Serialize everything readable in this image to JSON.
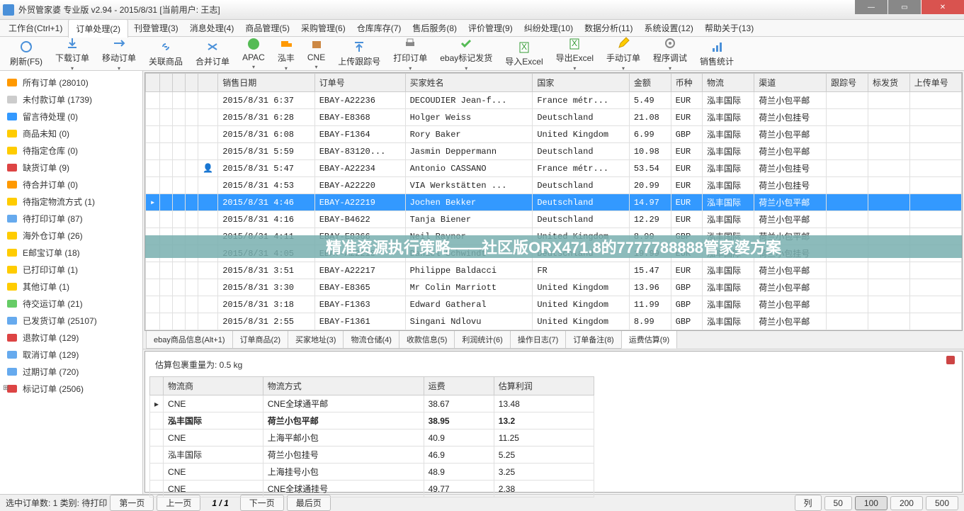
{
  "window": {
    "title": "外贸管家婆 专业版 v2.94 - 2015/8/31 [当前用户: 王志]"
  },
  "menu": {
    "workbench": "工作台(Ctrl+1)",
    "order_proc": "订单处理(2)",
    "listing": "刊登管理(3)",
    "msg": "消息处理(4)",
    "goods": "商品管理(5)",
    "purchase": "采购管理(6)",
    "warehouse": "仓库库存(7)",
    "aftersale": "售后服务(8)",
    "evaluate": "评价管理(9)",
    "dispute": "纠纷处理(10)",
    "analytics": "数据分析(11)",
    "settings": "系统设置(12)",
    "help": "帮助关于(13)"
  },
  "toolbar": {
    "refresh": "刷新(F5)",
    "download": "下载订单",
    "move": "移动订单",
    "relate": "关联商品",
    "merge": "合并订单",
    "apac": "APAC",
    "hongfeng": "泓丰",
    "cne": "CNE",
    "upload_track": "上传跟踪号",
    "print": "打印订单",
    "ship_mark": "ebay标记发货",
    "import": "导入Excel",
    "export": "导出Excel",
    "manual": "手动订单",
    "debug": "程序调试",
    "stats": "销售统计"
  },
  "sidebar": {
    "items": [
      {
        "label": "所有订单 (28010)",
        "color": "#ff9900"
      },
      {
        "label": "未付款订单 (1739)",
        "color": "#cccccc"
      },
      {
        "label": "留言待处理 (0)",
        "color": "#3399ff"
      },
      {
        "label": "商品未知 (0)",
        "color": "#ffcc00"
      },
      {
        "label": "待指定仓库 (0)",
        "color": "#ffcc00"
      },
      {
        "label": "缺货订单 (9)",
        "color": "#dd4444"
      },
      {
        "label": "待合并订单 (0)",
        "color": "#ff9900"
      },
      {
        "label": "待指定物流方式 (1)",
        "color": "#ffcc00"
      },
      {
        "label": "待打印订单 (87)",
        "color": "#66aaee"
      },
      {
        "label": "海外仓订单 (26)",
        "color": "#ffcc00"
      },
      {
        "label": "E邮宝订单 (18)",
        "color": "#ffcc00"
      },
      {
        "label": "已打印订单 (1)",
        "color": "#ffcc00"
      },
      {
        "label": "其他订单 (1)",
        "color": "#ffcc00"
      },
      {
        "label": "待交运订单 (21)",
        "color": "#66cc66"
      },
      {
        "label": "已发货订单 (25107)",
        "color": "#66aaee"
      },
      {
        "label": "退款订单 (129)",
        "color": "#dd4444"
      },
      {
        "label": "取消订单 (129)",
        "color": "#66aaee"
      },
      {
        "label": "过期订单 (720)",
        "color": "#66aaee"
      },
      {
        "label": "标记订单 (2506)",
        "color": "#dd4444"
      }
    ]
  },
  "grid": {
    "headers": {
      "sale_date": "销售日期",
      "order_no": "订单号",
      "buyer": "买家姓名",
      "country": "国家",
      "amount": "金额",
      "currency": "币种",
      "logistics": "物流",
      "channel": "渠道",
      "track": "跟踪号",
      "shipped": "标发货",
      "upload": "上传单号"
    },
    "rows": [
      {
        "date": "2015/8/31 6:37",
        "no": "EBAY-A22236",
        "buyer": "DECOUDIER Jean-f...",
        "country": "France métr...",
        "amt": "5.49",
        "cur": "EUR",
        "log": "泓丰国际",
        "ch": "荷兰小包平邮"
      },
      {
        "date": "2015/8/31 6:28",
        "no": "EBAY-E8368",
        "buyer": "Holger Weiss",
        "country": "Deutschland",
        "amt": "21.08",
        "cur": "EUR",
        "log": "泓丰国际",
        "ch": "荷兰小包挂号"
      },
      {
        "date": "2015/8/31 6:08",
        "no": "EBAY-F1364",
        "buyer": "Rory Baker",
        "country": "United Kingdom",
        "amt": "6.99",
        "cur": "GBP",
        "log": "泓丰国际",
        "ch": "荷兰小包平邮"
      },
      {
        "date": "2015/8/31 5:59",
        "no": "EBAY-83120...",
        "buyer": "Jasmin Deppermann",
        "country": "Deutschland",
        "amt": "10.98",
        "cur": "EUR",
        "log": "泓丰国际",
        "ch": "荷兰小包平邮"
      },
      {
        "date": "2015/8/31 5:47",
        "no": "EBAY-A22234",
        "buyer": "Antonio CASSANO",
        "country": "France métr...",
        "amt": "53.54",
        "cur": "EUR",
        "log": "泓丰国际",
        "ch": "荷兰小包挂号",
        "icon": true
      },
      {
        "date": "2015/8/31 4:53",
        "no": "EBAY-A22220",
        "buyer": "VIA Werkstätten ...",
        "country": "Deutschland",
        "amt": "20.99",
        "cur": "EUR",
        "log": "泓丰国际",
        "ch": "荷兰小包挂号"
      },
      {
        "date": "2015/8/31 4:46",
        "no": "EBAY-A22219",
        "buyer": "Jochen Bekker",
        "country": "Deutschland",
        "amt": "14.97",
        "cur": "EUR",
        "log": "泓丰国际",
        "ch": "荷兰小包平邮",
        "sel": true
      },
      {
        "date": "2015/8/31 4:16",
        "no": "EBAY-B4622",
        "buyer": "Tanja Biener",
        "country": "Deutschland",
        "amt": "12.29",
        "cur": "EUR",
        "log": "泓丰国际",
        "ch": "荷兰小包平邮"
      },
      {
        "date": "2015/8/31 4:11",
        "no": "EBAY-E8366",
        "buyer": "Neil Raynor",
        "country": "United Kingdom",
        "amt": "8.99",
        "cur": "GBP",
        "log": "泓丰国际",
        "ch": "荷兰小包平邮"
      },
      {
        "date": "2015/8/31 4:05",
        "no": "EBAY-A22218",
        "buyer": "Daniel Schwindt",
        "country": "Deutschland",
        "amt": "19.99",
        "cur": "EUR",
        "log": "泓丰国际",
        "ch": "荷兰小包挂号",
        "ov": true
      },
      {
        "date": "2015/8/31 3:51",
        "no": "EBAY-A22217",
        "buyer": "Philippe Baldacci",
        "country": "FR",
        "amt": "15.47",
        "cur": "EUR",
        "log": "泓丰国际",
        "ch": "荷兰小包平邮",
        "ov": true
      },
      {
        "date": "2015/8/31 3:30",
        "no": "EBAY-E8365",
        "buyer": "Mr Colin Marriott",
        "country": "United Kingdom",
        "amt": "13.96",
        "cur": "GBP",
        "log": "泓丰国际",
        "ch": "荷兰小包平邮"
      },
      {
        "date": "2015/8/31 3:18",
        "no": "EBAY-F1363",
        "buyer": "Edward Gatheral",
        "country": "United Kingdom",
        "amt": "11.99",
        "cur": "GBP",
        "log": "泓丰国际",
        "ch": "荷兰小包平邮"
      },
      {
        "date": "2015/8/31 2:55",
        "no": "EBAY-F1361",
        "buyer": "Singani Ndlovu",
        "country": "United Kingdom",
        "amt": "8.99",
        "cur": "GBP",
        "log": "泓丰国际",
        "ch": "荷兰小包平邮"
      }
    ]
  },
  "overlay": {
    "text": "精准资源执行策略——社区版ORX471.8的7777788888管家婆方案"
  },
  "subtabs": {
    "ebay_info": "ebay商品信息(Alt+1)",
    "order_goods": "订单商品(2)",
    "buyer_addr": "买家地址(3)",
    "wh_ship": "物流仓储(4)",
    "payment": "收款信息(5)",
    "profit": "利润统计(6)",
    "oplog": "操作日志(7)",
    "remark": "订单备注(8)",
    "freight": "运费估算(9)"
  },
  "freight": {
    "weight_label": "估算包裹重量为: 0.5 kg",
    "headers": {
      "provider": "物流商",
      "method": "物流方式",
      "fee": "运费",
      "profit": "估算利润"
    },
    "rows": [
      {
        "p": "CNE",
        "m": "CNE全球通平邮",
        "f": "38.67",
        "pr": "13.48"
      },
      {
        "p": "泓丰国际",
        "m": "荷兰小包平邮",
        "f": "38.95",
        "pr": "13.2",
        "bold": true
      },
      {
        "p": "CNE",
        "m": "上海平邮小包",
        "f": "40.9",
        "pr": "11.25"
      },
      {
        "p": "泓丰国际",
        "m": "荷兰小包挂号",
        "f": "46.9",
        "pr": "5.25"
      },
      {
        "p": "CNE",
        "m": "上海挂号小包",
        "f": "48.9",
        "pr": "3.25"
      },
      {
        "p": "CNE",
        "m": "CNE全球通挂号",
        "f": "49.77",
        "pr": "2.38"
      }
    ]
  },
  "footer": {
    "summary": "选中订单数: 1 类别: 待打印",
    "first": "第一页",
    "prev": "上一页",
    "page": "1 / 1",
    "next": "下一页",
    "last": "最后页",
    "col": "列",
    "b50": "50",
    "b100": "100",
    "b200": "200",
    "b500": "500"
  }
}
